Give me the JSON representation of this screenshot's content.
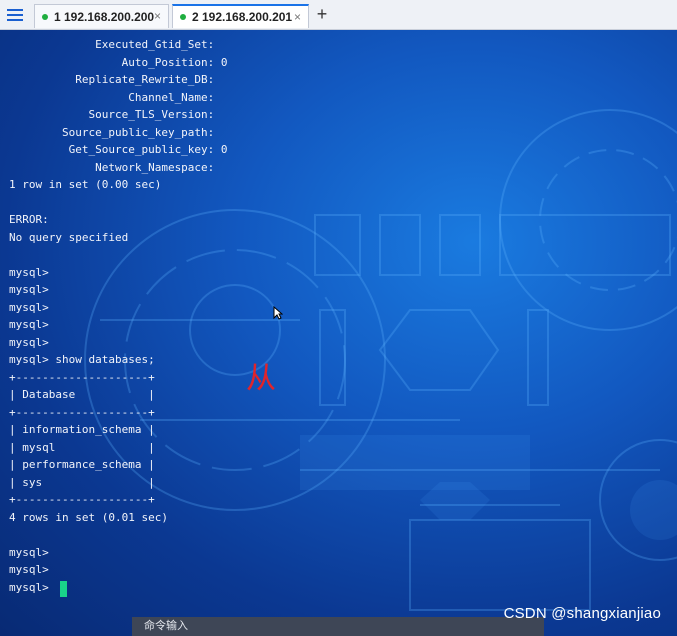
{
  "tabs": [
    {
      "label": "1 192.168.200.200",
      "close": "×",
      "status_color": "#1fae3f",
      "active": false
    },
    {
      "label": "2 192.168.200.201",
      "close": "×",
      "status_color": "#1fae3f",
      "active": true
    }
  ],
  "new_tab_label": "+",
  "menu_icon": "hamburger-menu-icon",
  "terminal": {
    "lines": [
      "             Executed_Gtid_Set:",
      "                 Auto_Position: 0",
      "          Replicate_Rewrite_DB:",
      "                  Channel_Name:",
      "            Source_TLS_Version:",
      "        Source_public_key_path:",
      "         Get_Source_public_key: 0",
      "             Network_Namespace:",
      "1 row in set (0.00 sec)",
      "",
      "ERROR:",
      "No query specified",
      "",
      "mysql>",
      "mysql>",
      "mysql>",
      "mysql>",
      "mysql>",
      "mysql> show databases;",
      "+--------------------+",
      "| Database           |",
      "+--------------------+",
      "| information_schema |",
      "| mysql              |",
      "| performance_schema |",
      "| sys                |",
      "+--------------------+",
      "4 rows in set (0.01 sec)",
      "",
      "mysql>",
      "mysql>",
      "mysql> "
    ],
    "cursor_color": "#19d38a"
  },
  "overlay_char": "从",
  "command_bar_label": "命令输入",
  "watermark_text": "CSDN @shangxianjiao"
}
